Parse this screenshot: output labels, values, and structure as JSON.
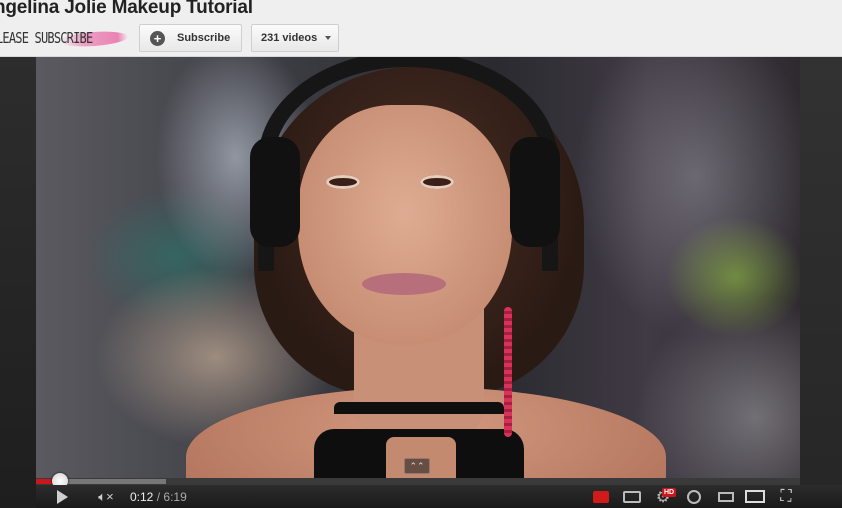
{
  "header": {
    "title": "ngelina Jolie Makeup Tutorial",
    "channel_name": "LEASE SUBSCRIBE",
    "subscribe_label": "Subscribe",
    "videos_label": "231 videos"
  },
  "player": {
    "current_time": "0:12",
    "separator": "/",
    "duration": "6:19",
    "played_fraction": 0.032,
    "buffered_fraction": 0.17,
    "hd_badge": "HD",
    "accent_color": "#c9171e"
  },
  "icons": {
    "subscribe": "plus-icon",
    "videos": "caret-down-icon",
    "play": "play-icon",
    "volume": "mute-icon",
    "captions": "captions-icon",
    "subtitles": "subtitles-icon",
    "settings": "gear-icon",
    "watch_later": "clock-icon",
    "small_player": "small-player-icon",
    "large_player": "large-player-icon",
    "fullscreen": "fullscreen-icon",
    "expand": "expand-up-icon"
  }
}
